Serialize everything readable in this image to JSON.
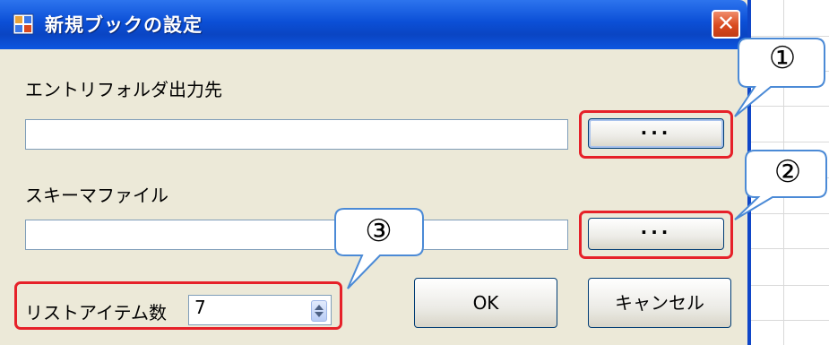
{
  "dialog": {
    "title": "新規ブックの設定",
    "close_glyph": "✕"
  },
  "fields": {
    "entry_folder_label": "エントリフォルダ出力先",
    "entry_folder_value": "",
    "schema_file_label": "スキーマファイル",
    "schema_file_value": "",
    "browse_label": "···",
    "list_items_label": "リストアイテム数",
    "list_items_value": "7"
  },
  "buttons": {
    "ok": "OK",
    "cancel": "キャンセル"
  },
  "annotations": {
    "callout_1": "①",
    "callout_2": "②",
    "callout_3": "③",
    "highlight_color": "#e62129"
  },
  "icons": {
    "title_icon": "window-app-icon",
    "spinner": "up-down-arrows-icon"
  }
}
